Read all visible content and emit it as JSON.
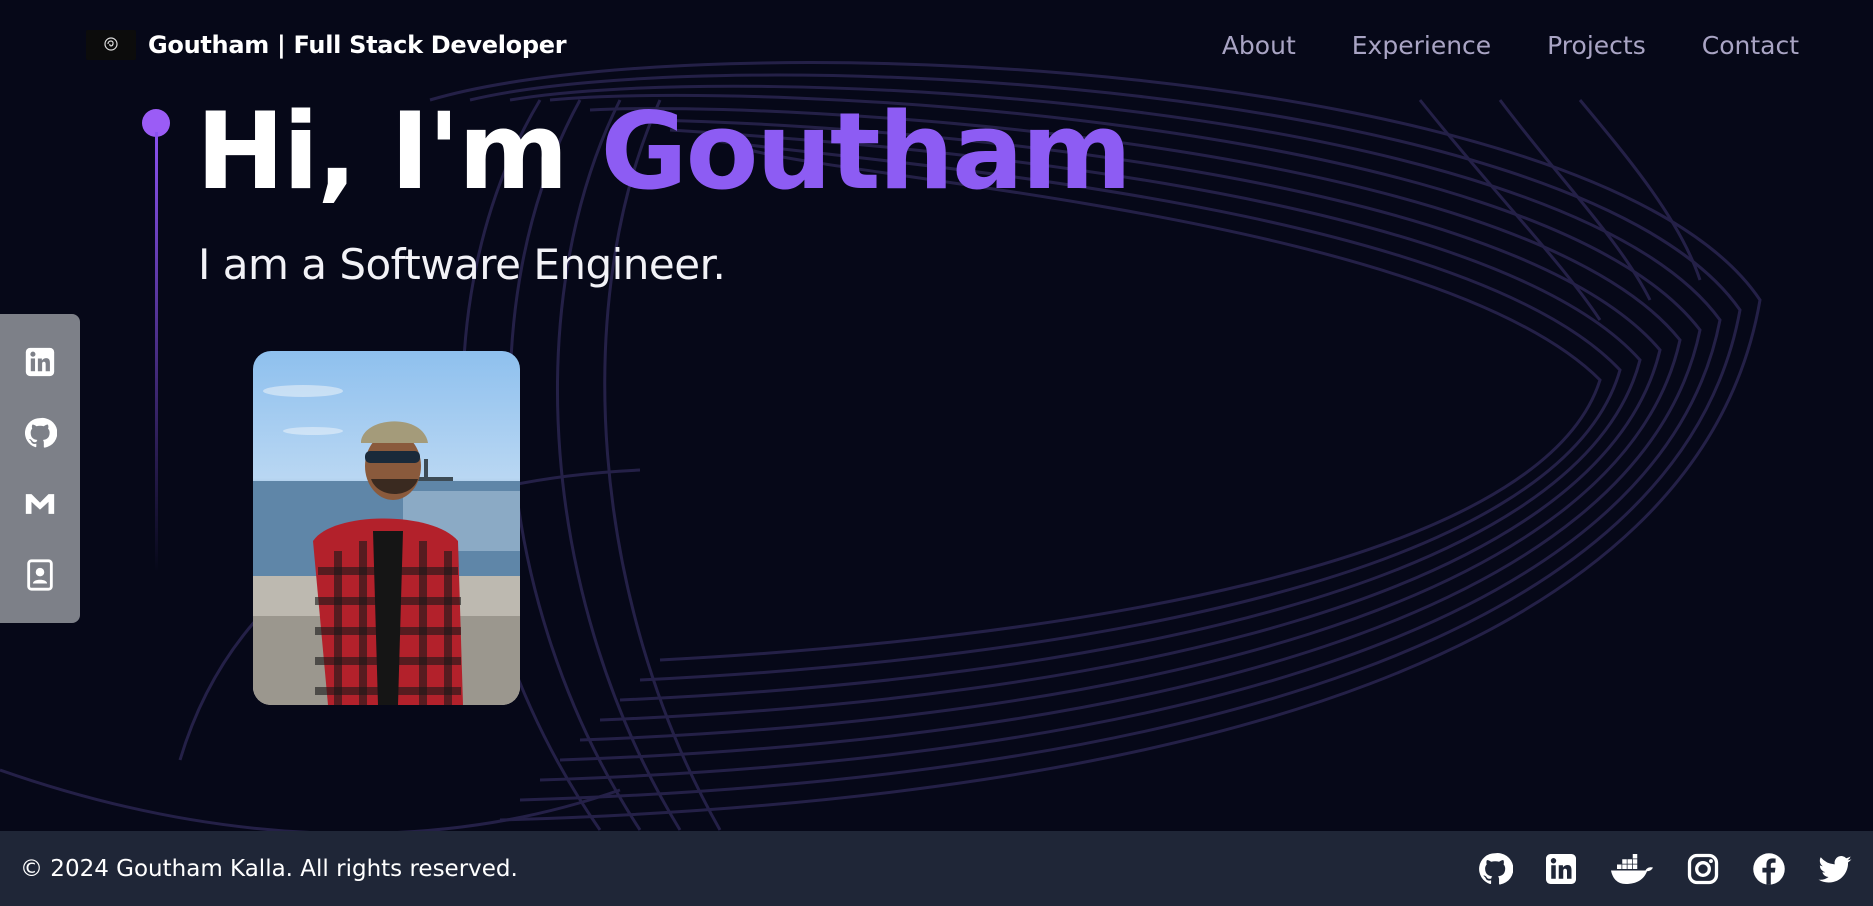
{
  "header": {
    "brand": "Goutham  | Full Stack Developer",
    "logo_icon": "goutham-logo-icon",
    "nav": [
      {
        "label": "About"
      },
      {
        "label": "Experience"
      },
      {
        "label": "Projects"
      },
      {
        "label": "Contact"
      }
    ]
  },
  "hero": {
    "greeting": "Hi, I'm",
    "name": "Goutham",
    "subtitle": "I am a Software Engineer.",
    "accent_color": "#8d5cf3"
  },
  "side_social": [
    {
      "icon": "linkedin-icon"
    },
    {
      "icon": "github-icon"
    },
    {
      "icon": "gmail-icon"
    },
    {
      "icon": "contact-card-icon"
    }
  ],
  "footer": {
    "copyright": "© 2024 Goutham Kalla. All rights reserved.",
    "icons": [
      "github-icon",
      "linkedin-icon",
      "docker-icon",
      "instagram-icon",
      "facebook-icon",
      "twitter-icon"
    ]
  }
}
